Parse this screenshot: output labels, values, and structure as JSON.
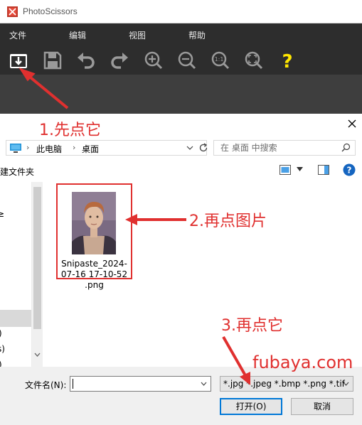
{
  "app": {
    "title": "PhotoScissors",
    "menu": [
      "文件",
      "编辑",
      "视图",
      "帮助"
    ],
    "toolbar": [
      "open-icon",
      "save-icon",
      "undo-icon",
      "redo-icon",
      "zoom-in-icon",
      "zoom-out-icon",
      "actual-size-icon",
      "fit-icon",
      "help-icon"
    ],
    "actual_size_label": "1:1",
    "help_label": "?"
  },
  "dialog": {
    "breadcrumb": [
      "此电脑",
      "桌面"
    ],
    "search_placeholder": "在 桌面 中搜索",
    "new_folder": "新建文件夹",
    "nav_fragments": [
      "≥",
      ")",
      "s)",
      ")"
    ],
    "file": {
      "name_line1": "Snipaste_2024-",
      "name_line2": "07-16 17-10-52",
      "name_line3": ".png"
    },
    "filename_label": "文件名(N):",
    "filename_value": "",
    "filetype": "*.jpg *.jpeg *.bmp *.png *.tif",
    "open_label": "打开(O)",
    "cancel_label": "取消"
  },
  "annotations": {
    "step1": "1.先点它",
    "step2": "2.再点图片",
    "step3": "3.再点它",
    "watermark": "fubaya.com"
  },
  "colors": {
    "annotation_red": "#e0302f",
    "app_dark": "#2d2d2d",
    "help_yellow": "#ffe600",
    "focus_blue": "#0078d7"
  }
}
